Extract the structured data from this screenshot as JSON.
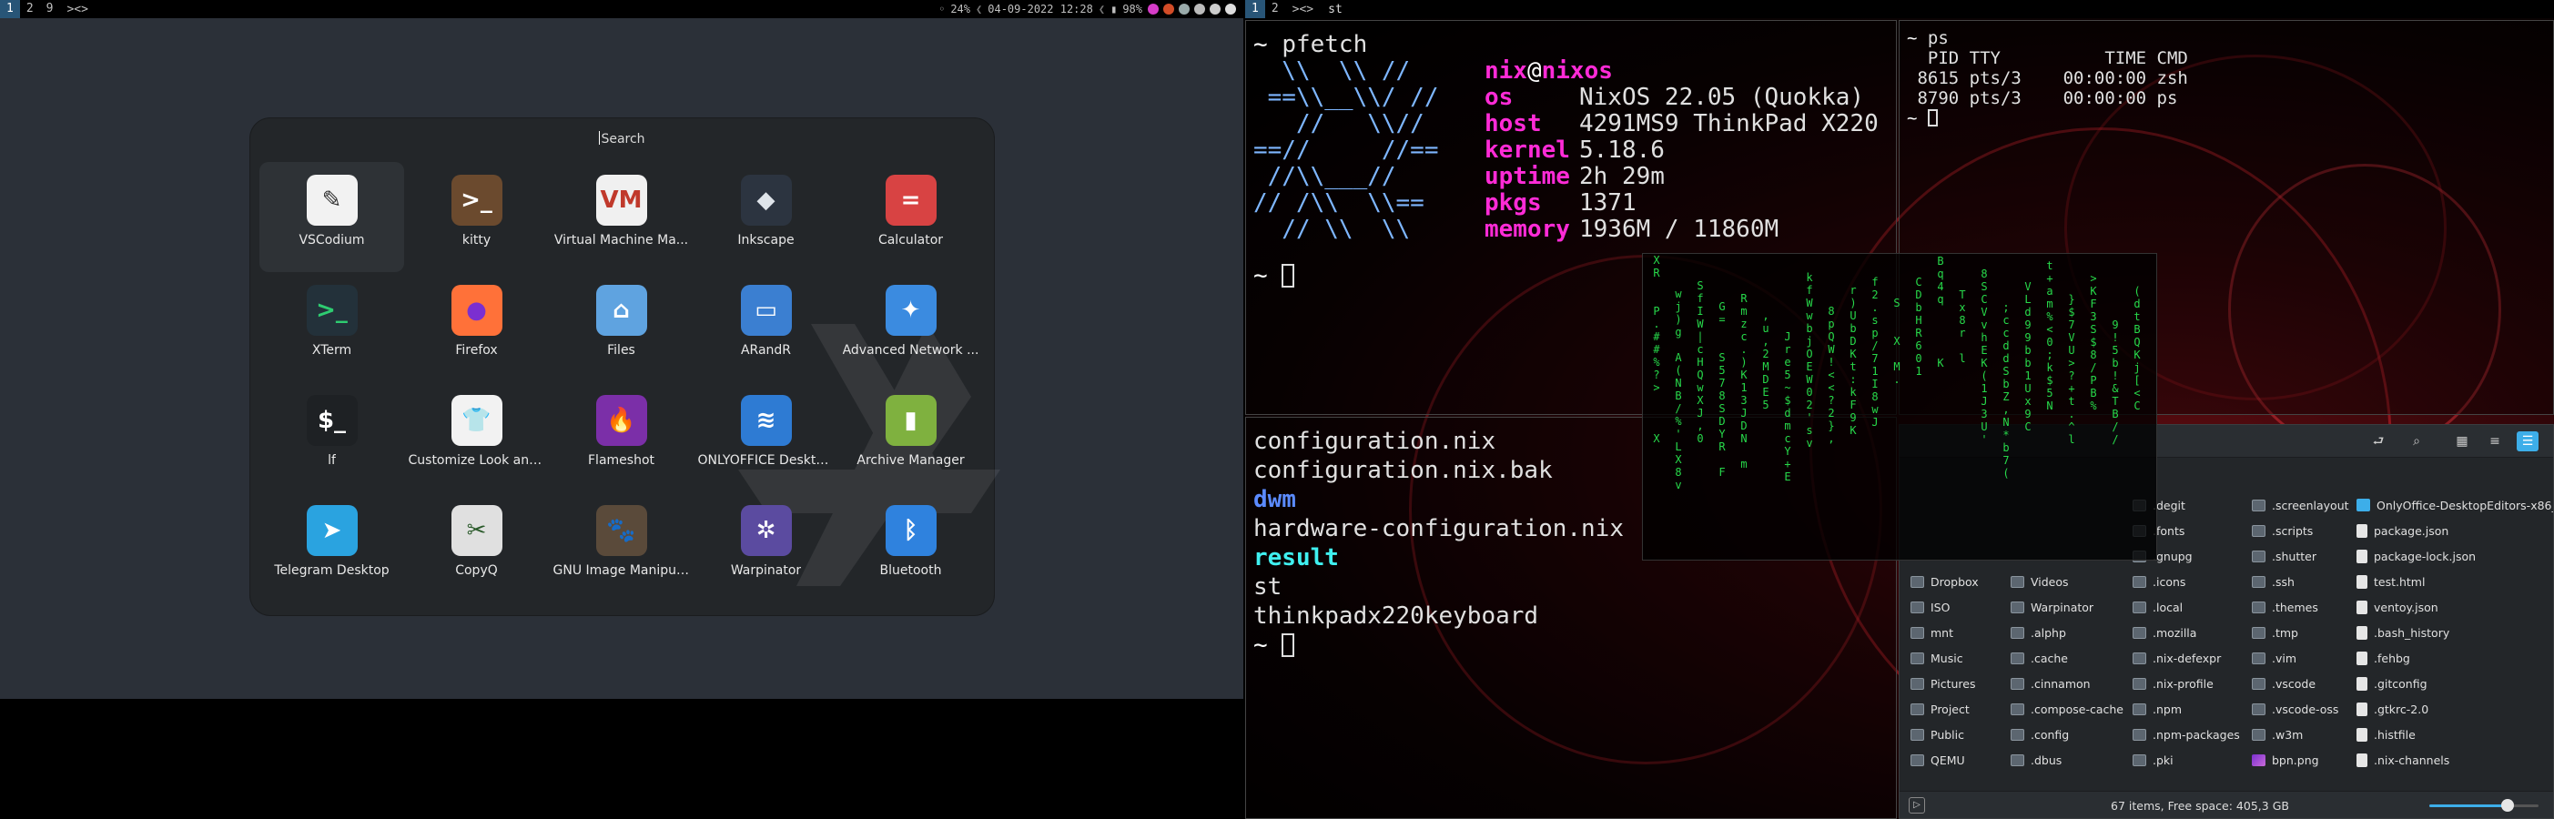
{
  "bar_left": {
    "tags": [
      "1",
      "2",
      "9"
    ],
    "layout": "><>",
    "status": {
      "cpu": "24%",
      "sep1": "❮",
      "datetime": "04-09-2022 12:28",
      "sep2": "❮",
      "battery": "98%"
    }
  },
  "bar_right": {
    "tags": [
      "1",
      "2"
    ],
    "layout": "><>",
    "title": "st"
  },
  "launcher": {
    "search_placeholder": "Search",
    "apps": [
      {
        "label": "VSCodium",
        "icon": "vscodium-icon",
        "color": "#f2f2f2",
        "glyph": "✎",
        "glyph_color": "#333"
      },
      {
        "label": "kitty",
        "icon": "kitty-icon",
        "color": "#6b4a2e",
        "glyph": ">_",
        "glyph_color": "#fff"
      },
      {
        "label": "Virtual Machine Ma...",
        "icon": "virt-manager-icon",
        "color": "#f0f0f0",
        "glyph": "VM",
        "glyph_color": "#c0392b"
      },
      {
        "label": "Inkscape",
        "icon": "inkscape-icon",
        "color": "#2c3440",
        "glyph": "◆",
        "glyph_color": "#dfe4ea"
      },
      {
        "label": "Calculator",
        "icon": "calculator-icon",
        "color": "#d84343",
        "glyph": "=",
        "glyph_color": "#fff"
      },
      {
        "label": "XTerm",
        "icon": "xterm-icon",
        "color": "#23313a",
        "glyph": ">_",
        "glyph_color": "#2ecc71"
      },
      {
        "label": "Firefox",
        "icon": "firefox-icon",
        "color": "#ff7139",
        "glyph": "●",
        "glyph_color": "#7b2fd0"
      },
      {
        "label": "Files",
        "icon": "files-icon",
        "color": "#5fa3e0",
        "glyph": "⌂",
        "glyph_color": "#fff"
      },
      {
        "label": "ARandR",
        "icon": "arandr-icon",
        "color": "#3b7fd1",
        "glyph": "▭",
        "glyph_color": "#fff"
      },
      {
        "label": "Advanced Network ...",
        "icon": "network-icon",
        "color": "#3b8be0",
        "glyph": "✦",
        "glyph_color": "#fff"
      },
      {
        "label": "lf",
        "icon": "lf-icon",
        "color": "#1e2124",
        "glyph": "$_",
        "glyph_color": "#fff"
      },
      {
        "label": "Customize Look and...",
        "icon": "lxappearance-icon",
        "color": "#f2f2f2",
        "glyph": "👕",
        "glyph_color": "#333"
      },
      {
        "label": "Flameshot",
        "icon": "flameshot-icon",
        "color": "#7b2fa8",
        "glyph": "🔥",
        "glyph_color": "#fff"
      },
      {
        "label": "ONLYOFFICE Deskto...",
        "icon": "onlyoffice-icon",
        "color": "#2e7bd3",
        "glyph": "≋",
        "glyph_color": "#fff"
      },
      {
        "label": "Archive Manager",
        "icon": "archive-manager-icon",
        "color": "#7fb13f",
        "glyph": "▮",
        "glyph_color": "#fff"
      },
      {
        "label": "Telegram Desktop",
        "icon": "telegram-icon",
        "color": "#2aa3e0",
        "glyph": "➤",
        "glyph_color": "#fff"
      },
      {
        "label": "CopyQ",
        "icon": "copyq-icon",
        "color": "#e0e0e0",
        "glyph": "✂",
        "glyph_color": "#2a5a2a"
      },
      {
        "label": "GNU Image Manipul...",
        "icon": "gimp-icon",
        "color": "#5a4a3a",
        "glyph": "🐾",
        "glyph_color": "#fff"
      },
      {
        "label": "Warpinator",
        "icon": "warpinator-icon",
        "color": "#5b4ba0",
        "glyph": "✲",
        "glyph_color": "#fff"
      },
      {
        "label": "Bluetooth",
        "icon": "bluetooth-icon",
        "color": "#2f82de",
        "glyph": "ᛒ",
        "glyph_color": "#fff"
      }
    ]
  },
  "pfetch": {
    "command": "pfetch",
    "logo": [
      "  \\\\  \\\\ //",
      " ==\\\\__\\\\/ //",
      "   //   \\\\//",
      "==//     //==",
      " //\\\\___//",
      "// /\\\\  \\\\==",
      "  // \\\\  \\\\"
    ],
    "user": "nix",
    "at": "@",
    "host_name": "nixos",
    "rows": [
      {
        "key": "os",
        "value": "NixOS 22.05 (Quokka)"
      },
      {
        "key": "host",
        "value": "4291MS9 ThinkPad X220"
      },
      {
        "key": "kernel",
        "value": "5.18.6"
      },
      {
        "key": "uptime",
        "value": "2h 29m"
      },
      {
        "key": "pkgs",
        "value": "1371"
      },
      {
        "key": "memory",
        "value": "1936M / 11860M"
      }
    ],
    "prompt": "~"
  },
  "ps": {
    "command": "ps",
    "header": "  PID TTY          TIME CMD",
    "rows": [
      " 8615 pts/3    00:00:00 zsh",
      " 8790 pts/3    00:00:00 ps"
    ],
    "prompt": "~"
  },
  "ls": {
    "entries": [
      {
        "name": "configuration.nix",
        "kind": "file"
      },
      {
        "name": "configuration.nix.bak",
        "kind": "file"
      },
      {
        "name": "dwm",
        "kind": "dir"
      },
      {
        "name": "hardware-configuration.nix",
        "kind": "file"
      },
      {
        "name": "result",
        "kind": "link"
      },
      {
        "name": "st",
        "kind": "file"
      },
      {
        "name": "thinkpadx220keyboard",
        "kind": "file"
      }
    ],
    "prompt": "~"
  },
  "matrix": {
    "columns": [
      "X\nR\n\n\nP\n.\n#\n#\n%\n?\n>\n\n\n\nX\n",
      "w\nj\n)\ng\n\nA\n(\nN\nB\n/\n%\n'\nL\nX\n8\nv",
      "\nS\nf\nI\nW\n|\nc\nH\nQ\nw\nX\nJ\n,\n0\n\n",
      "G\n=\n\n\nS\n5\n7\n8\nS\nD\nY\nR\n\nF\n \n",
      "\nR\nm\nz\nc\n.\n)\nK\n1\n3\nJ\nD\nN\n \nm",
      "\n\n\n\n,\nu\n,\n2\nM\nD\nE\n5\n \n \n\n",
      "\n\n\nJ\nr\ne\n5\n~\n$\nd\nm\nc\nY\n+\nE",
      "k\nf\nW\nw\nb\nj\nO\nE\nW\n0\n2\n'\ns\nv\n",
      "8\np\nQ\nW\n!\n<\n<\n?\n2\n}\n,\n\n\n\n",
      "r\n)\nU\nb\nD\nK\nt\n:\nk\nF\n9\nK\n\n\n",
      "\nf\n2\n.\ns\np\n/\n7\n1\nI\n8\nw\nJ\n\n",
      "S\n\n\nX\n\nM\n.\n\n\n\n\n\n\n\n",
      "C\nD\nb\nH\nR\n6\n0\n1\n\n\n\n\n\n\n",
      "B\nq\n4\nq\n\n\n\n\nK\n\n\n\n\n\n",
      "T\nx\n8\nr\n\nl\n\n\n\n\n\n\n\n\n",
      "8\nS\nC\nV\nv\nh\nE\nK\n(\n1\nJ\n3\nU\n'\n",
      ";\nc\nc\nd\nd\nS\nb\nZ\n,\nN\n*\nb\n7\n(\n",
      "V\nL\nd\n9\n9\nb\nb\n1\nU\nx\n9\nC\n\n\n",
      "t\n+\na\nm\n%\n<\n0\n;\nk\n$\n5\nN\n\n\n",
      "}\n$\n7\nV\nU\n>\n?\n+\nt\n.\n^\nl\n\n\n",
      ">\nK\nF\n3\nS\n$\n8\n/\nP\nB\n%\n \n\n\n",
      "\n9\n!\n5\nb\n!\n&\nT\nB\n/\n/\n\n\n\n",
      "(\nd\nt\nB\nQ\nK\nj\n[\n<\nC\n \n \n\n\n"
    ]
  },
  "filemanager": {
    "toolbar": {
      "back": "⮐",
      "search": "⌕",
      "view_icons": "▦",
      "view_compact": "≡",
      "view_details": "☰"
    },
    "items": [
      {
        "name": ".degit",
        "type": "folder"
      },
      {
        "name": ".screenlayout",
        "type": "folder"
      },
      {
        "name": "OnlyOffice-DesktopEditors-x86_64.AppImage",
        "type": "app"
      },
      {
        "name": ".fonts",
        "type": "folder"
      },
      {
        "name": ".scripts",
        "type": "folder"
      },
      {
        "name": "package.json",
        "type": "file"
      },
      {
        "name": ".gnupg",
        "type": "folder"
      },
      {
        "name": ".shutter",
        "type": "folder"
      },
      {
        "name": "package-lock.json",
        "type": "file"
      },
      {
        "name": "Dropbox",
        "type": "folder"
      },
      {
        "name": "Videos",
        "type": "folder"
      },
      {
        "name": ".icons",
        "type": "folder"
      },
      {
        "name": ".ssh",
        "type": "folder"
      },
      {
        "name": "test.html",
        "type": "file"
      },
      {
        "name": "ISO",
        "type": "folder"
      },
      {
        "name": "Warpinator",
        "type": "folder"
      },
      {
        "name": ".local",
        "type": "folder"
      },
      {
        "name": ".themes",
        "type": "folder"
      },
      {
        "name": "ventoy.json",
        "type": "file"
      },
      {
        "name": "mnt",
        "type": "folder"
      },
      {
        "name": ".alphp",
        "type": "folder"
      },
      {
        "name": ".mozilla",
        "type": "folder"
      },
      {
        "name": ".tmp",
        "type": "folder"
      },
      {
        "name": ".bash_history",
        "type": "file"
      },
      {
        "name": "Music",
        "type": "folder"
      },
      {
        "name": ".cache",
        "type": "folder"
      },
      {
        "name": ".nix-defexpr",
        "type": "folder"
      },
      {
        "name": ".vim",
        "type": "folder"
      },
      {
        "name": ".fehbg",
        "type": "file"
      },
      {
        "name": "Pictures",
        "type": "folder"
      },
      {
        "name": ".cinnamon",
        "type": "folder"
      },
      {
        "name": ".nix-profile",
        "type": "folder"
      },
      {
        "name": ".vscode",
        "type": "folder"
      },
      {
        "name": ".gitconfig",
        "type": "file"
      },
      {
        "name": "Project",
        "type": "folder"
      },
      {
        "name": ".compose-cache",
        "type": "folder"
      },
      {
        "name": ".npm",
        "type": "folder"
      },
      {
        "name": ".vscode-oss",
        "type": "folder"
      },
      {
        "name": ".gtkrc-2.0",
        "type": "file"
      },
      {
        "name": "Public",
        "type": "folder"
      },
      {
        "name": ".config",
        "type": "folder"
      },
      {
        "name": ".npm-packages",
        "type": "folder"
      },
      {
        "name": ".w3m",
        "type": "folder"
      },
      {
        "name": ".histfile",
        "type": "file"
      },
      {
        "name": "QEMU",
        "type": "folder"
      },
      {
        "name": ".dbus",
        "type": "folder"
      },
      {
        "name": ".pki",
        "type": "folder"
      },
      {
        "name": "bpn.png",
        "type": "img"
      },
      {
        "name": ".nix-channels",
        "type": "file"
      }
    ],
    "status": "67 items, Free space: 405,3 GB",
    "zoom_level": 0.72
  },
  "colors": {
    "accent": "#3daee9",
    "tag_selected": "#285577",
    "pfetch_key": "#ff2bd7",
    "matrix": "#27d94a"
  }
}
